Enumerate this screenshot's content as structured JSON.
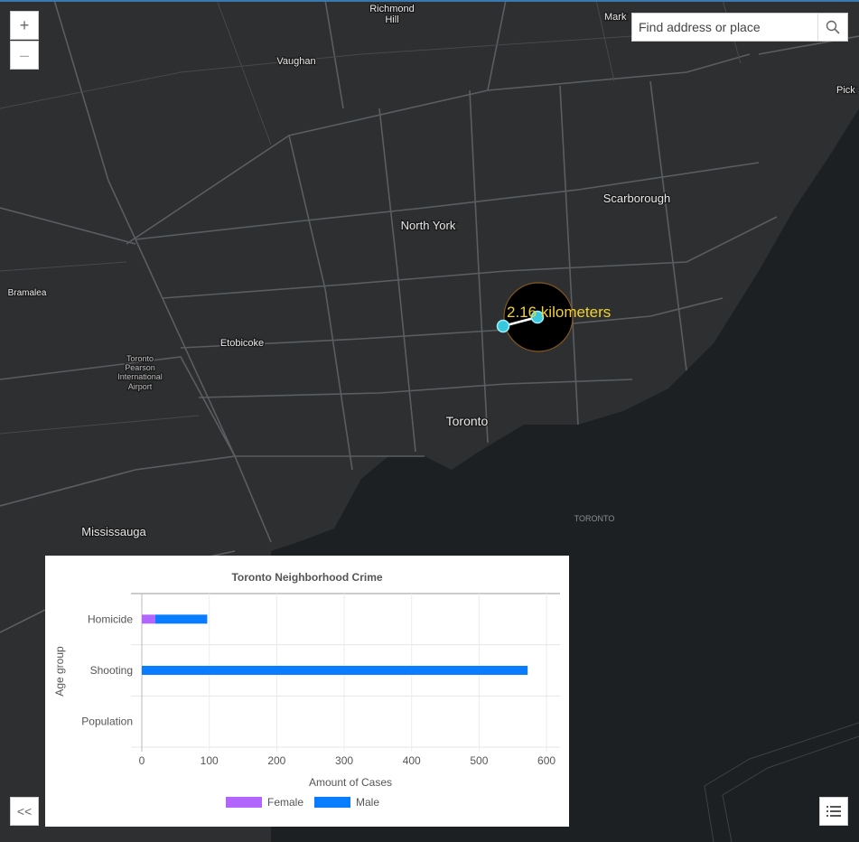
{
  "search": {
    "placeholder": "Find address or place"
  },
  "zoom": {
    "in_label": "+",
    "out_label": "–"
  },
  "nav": {
    "collapse_label": "<<"
  },
  "map": {
    "labels": {
      "richmond": "Richmond",
      "hill": "Hill",
      "markham": "Mark",
      "vaughan": "Vaughan",
      "pickering": "Pick",
      "scarborough": "Scarborough",
      "north_york": "North York",
      "bramalea": "Bramalea",
      "etobicoke": "Etobicoke",
      "airport1": "Toronto",
      "airport2": "Pearson",
      "airport3": "International",
      "airport4": "Airport",
      "toronto": "Toronto",
      "toronto_water": "TORONTO",
      "mississauga": "Mississauga"
    },
    "measure": {
      "text": "2.16 kilometers"
    },
    "colors": {
      "land": "#303234",
      "water": "#1d2023",
      "roads": "#5a5d60",
      "measure_text": "#f2d22e",
      "measure_point": "#37c8dd"
    }
  },
  "chart_data": {
    "type": "bar",
    "orientation": "horizontal",
    "stacked": true,
    "title": "Toronto Neighborhood Crime",
    "xlabel": "Amount of Cases",
    "ylabel": "Age group",
    "categories": [
      "Homicide",
      "Shooting",
      "Population"
    ],
    "series": [
      {
        "name": "Female",
        "color": "#b366ff",
        "values": [
          20,
          0,
          0
        ]
      },
      {
        "name": "Male",
        "color": "#0a7cff",
        "values": [
          77,
          572,
          0
        ]
      }
    ],
    "xlim": [
      0,
      620
    ],
    "xticks": [
      0,
      100,
      200,
      300,
      400,
      500,
      600
    ],
    "legend": "bottom",
    "grid": true
  }
}
